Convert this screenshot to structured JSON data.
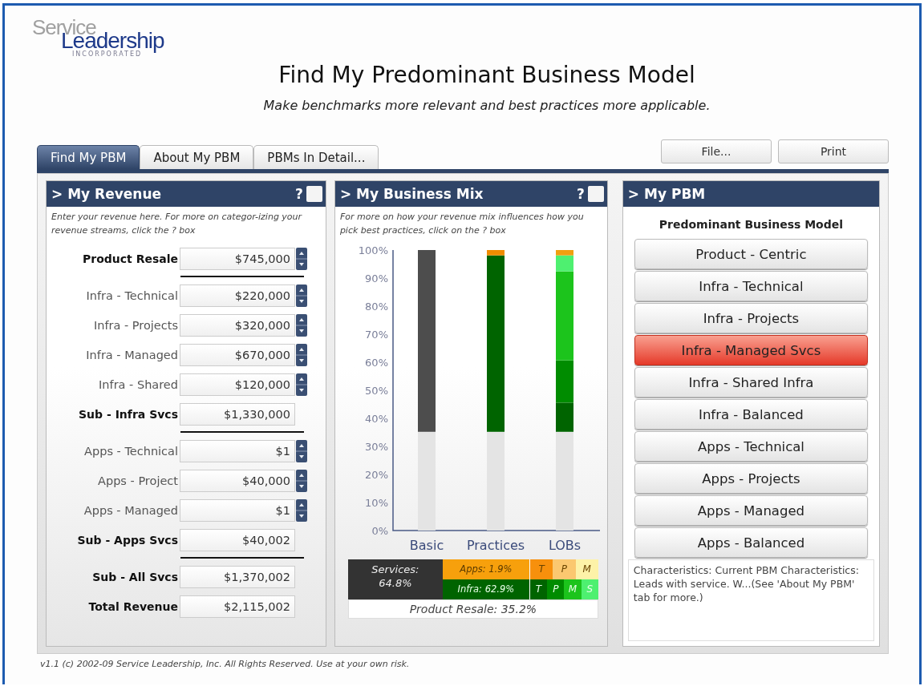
{
  "logo": {
    "top": "Service",
    "bottom": "Leadership",
    "tagline": "INCORPORATED"
  },
  "title": "Find My Predominant Business Model",
  "subtitle": "Make benchmarks more relevant and best practices more applicable.",
  "tabs": [
    {
      "label": "Find My PBM",
      "selected": true
    },
    {
      "label": "About My PBM",
      "selected": false
    },
    {
      "label": "PBMs In Detail...",
      "selected": false
    }
  ],
  "actions": [
    "File...",
    "Print"
  ],
  "revenue_panel": {
    "title": "> My Revenue",
    "help": "?",
    "help_checked": false,
    "hint": "Enter your revenue here. For more on categor-izing your revenue streams, click the ? box",
    "rows": [
      {
        "label": "Product Resale",
        "value": "$745,000",
        "kind": "key",
        "divider_after": true
      },
      {
        "label": "Infra - Technical",
        "value": "$220,000",
        "kind": "input",
        "divider_after": false
      },
      {
        "label": "Infra - Projects",
        "value": "$320,000",
        "kind": "input",
        "divider_after": false
      },
      {
        "label": "Infra - Managed",
        "value": "$670,000",
        "kind": "input",
        "divider_after": false
      },
      {
        "label": "Infra - Shared",
        "value": "$120,000",
        "kind": "input",
        "divider_after": false
      },
      {
        "label": "Sub - Infra Svcs",
        "value": "$1,330,000",
        "kind": "total",
        "divider_after": true
      },
      {
        "label": "Apps - Technical",
        "value": "$1",
        "kind": "input",
        "divider_after": false
      },
      {
        "label": "Apps - Project",
        "value": "$40,000",
        "kind": "input",
        "divider_after": false
      },
      {
        "label": "Apps - Managed",
        "value": "$1",
        "kind": "input",
        "divider_after": false
      },
      {
        "label": "Sub - Apps Svcs",
        "value": "$40,002",
        "kind": "total",
        "divider_after": true
      },
      {
        "label": "Sub - All Svcs",
        "value": "$1,370,002",
        "kind": "total",
        "divider_after": false
      },
      {
        "label": "Total Revenue",
        "value": "$2,115,002",
        "kind": "total",
        "divider_after": false
      }
    ]
  },
  "mix_panel": {
    "title": "> My Business Mix",
    "help": "?",
    "help_checked": false,
    "hint": "For more on how your revenue mix influences how you pick best practices, click on the ? box",
    "chart_data": {
      "type": "bar",
      "stacked": true,
      "categories": [
        "Basic",
        "Practices",
        "LOBs"
      ],
      "ylim": [
        0,
        100
      ],
      "yticks": [
        {
          "value": 0,
          "label": "0%"
        },
        {
          "value": 10,
          "label": "10%"
        },
        {
          "value": 20,
          "label": "20%"
        },
        {
          "value": 30,
          "label": "30%"
        },
        {
          "value": 40,
          "label": "40%"
        },
        {
          "value": 50,
          "label": "50%"
        },
        {
          "value": 60,
          "label": "60%"
        },
        {
          "value": 70,
          "label": "70%"
        },
        {
          "value": 80,
          "label": "80%"
        },
        {
          "value": 90,
          "label": "90%"
        },
        {
          "value": 100,
          "label": "100%"
        }
      ],
      "series": [
        {
          "color": "#e4e4e4",
          "values": [
            35.2,
            35.2,
            35.2
          ]
        },
        {
          "color": "#4d4d4d",
          "values": [
            64.8,
            null,
            null
          ]
        },
        {
          "color": "#006400",
          "values": [
            null,
            62.9,
            null
          ]
        },
        {
          "color": "#f08c00",
          "values": [
            null,
            1.9,
            null
          ]
        },
        {
          "color": "#006400",
          "values": [
            null,
            null,
            10.4
          ]
        },
        {
          "color": "#008c00",
          "values": [
            null,
            null,
            15.1
          ]
        },
        {
          "color": "#1cc41c",
          "values": [
            null,
            null,
            31.7
          ]
        },
        {
          "color": "#4ef070",
          "values": [
            null,
            null,
            5.7
          ]
        },
        {
          "color": "#f0a010",
          "values": [
            null,
            null,
            1.9
          ]
        }
      ]
    },
    "summary": {
      "services": "Services: 64.8%",
      "product": "Product Resale: 35.2%",
      "groups": [
        {
          "label": "Apps: 1.9%",
          "color": "#f7a00c",
          "letters": [
            {
              "text": "T",
              "color": "#f7900c"
            },
            {
              "text": "P",
              "color": "#fbc870"
            },
            {
              "text": "M",
              "color": "#fdf2a8"
            }
          ]
        },
        {
          "label": "Infra: 62.9%",
          "color": "#006400",
          "letters": [
            {
              "text": "T",
              "color": "#006400"
            },
            {
              "text": "P",
              "color": "#008c00"
            },
            {
              "text": "M",
              "color": "#1cc41c"
            },
            {
              "text": "S",
              "color": "#4ef070"
            }
          ]
        }
      ]
    }
  },
  "pbm_panel": {
    "title": "> My PBM",
    "heading": "Predominant Business Model",
    "models": [
      {
        "label": "Product - Centric",
        "selected": false
      },
      {
        "label": "Infra - Technical",
        "selected": false
      },
      {
        "label": "Infra - Projects",
        "selected": false
      },
      {
        "label": "Infra - Managed Svcs",
        "selected": true
      },
      {
        "label": "Infra - Shared Infra",
        "selected": false
      },
      {
        "label": "Infra - Balanced",
        "selected": false
      },
      {
        "label": "Apps - Technical",
        "selected": false
      },
      {
        "label": "Apps - Projects",
        "selected": false
      },
      {
        "label": "Apps - Managed",
        "selected": false
      },
      {
        "label": "Apps - Balanced",
        "selected": false
      }
    ],
    "description": "Characteristics: Current PBM Characteristics: Leads with service. W...(See 'About My PBM' tab for more.)"
  },
  "footer": "v1.1 (c) 2002-09 Service Leadership, Inc. All Rights Reserved. Use at your own risk."
}
